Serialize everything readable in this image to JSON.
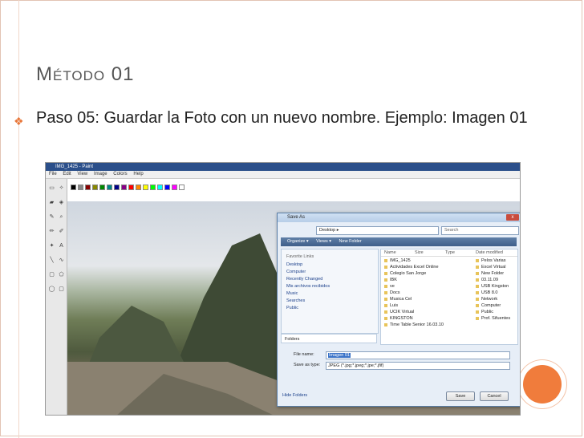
{
  "slide": {
    "title": "Método 01",
    "bullet": "Paso 05: Guardar la Foto con un nuevo nombre. Ejemplo: Imagen 01",
    "accent": "#f07c3c"
  },
  "paint": {
    "window_title": "IMG_1425 - Paint",
    "menu": [
      "File",
      "Edit",
      "View",
      "Image",
      "Colors",
      "Help"
    ]
  },
  "dialog": {
    "title": "Save As",
    "close_label": "x",
    "address": "Desktop ▸",
    "search_placeholder": "Search",
    "toolbar": {
      "organize": "Organize ▾",
      "views": "Views ▾",
      "new_folder": "New Folder"
    },
    "favorite_links_header": "Favorite Links",
    "favorite_links": [
      "Desktop",
      "Computer",
      "Recently Changed",
      "Mis archivos recibidos",
      "Music",
      "Searches",
      "Public"
    ],
    "folders_label": "Folders",
    "columns": [
      "Name",
      "Size",
      "Type",
      "Date modified"
    ],
    "files_col1": [
      "IMG_1425",
      "Actividades Excel Online",
      "Colegio San Jorge",
      "IBK",
      "ve",
      "Docs",
      "Musica Cel",
      "Luis",
      "UCIK Virtual",
      "KINGSTON",
      "Time Table Senior 16.03.10"
    ],
    "files_col2": [
      "Pelos Varias",
      "Excel Virtual",
      "New Folder",
      "03.11.09",
      "USB Kingston",
      "USB 8.0",
      "Network",
      "Computer",
      "Public",
      "Prof. Sifuentes"
    ],
    "file_name_label": "File name:",
    "file_name_value": "Imagen 01",
    "save_type_label": "Save as type:",
    "save_type_value": "JPEG (*.jpg;*.jpeg;*.jpe;*.jfif)",
    "hide_folders": "Hide Folders",
    "save_button": "Save",
    "cancel_button": "Cancel"
  }
}
